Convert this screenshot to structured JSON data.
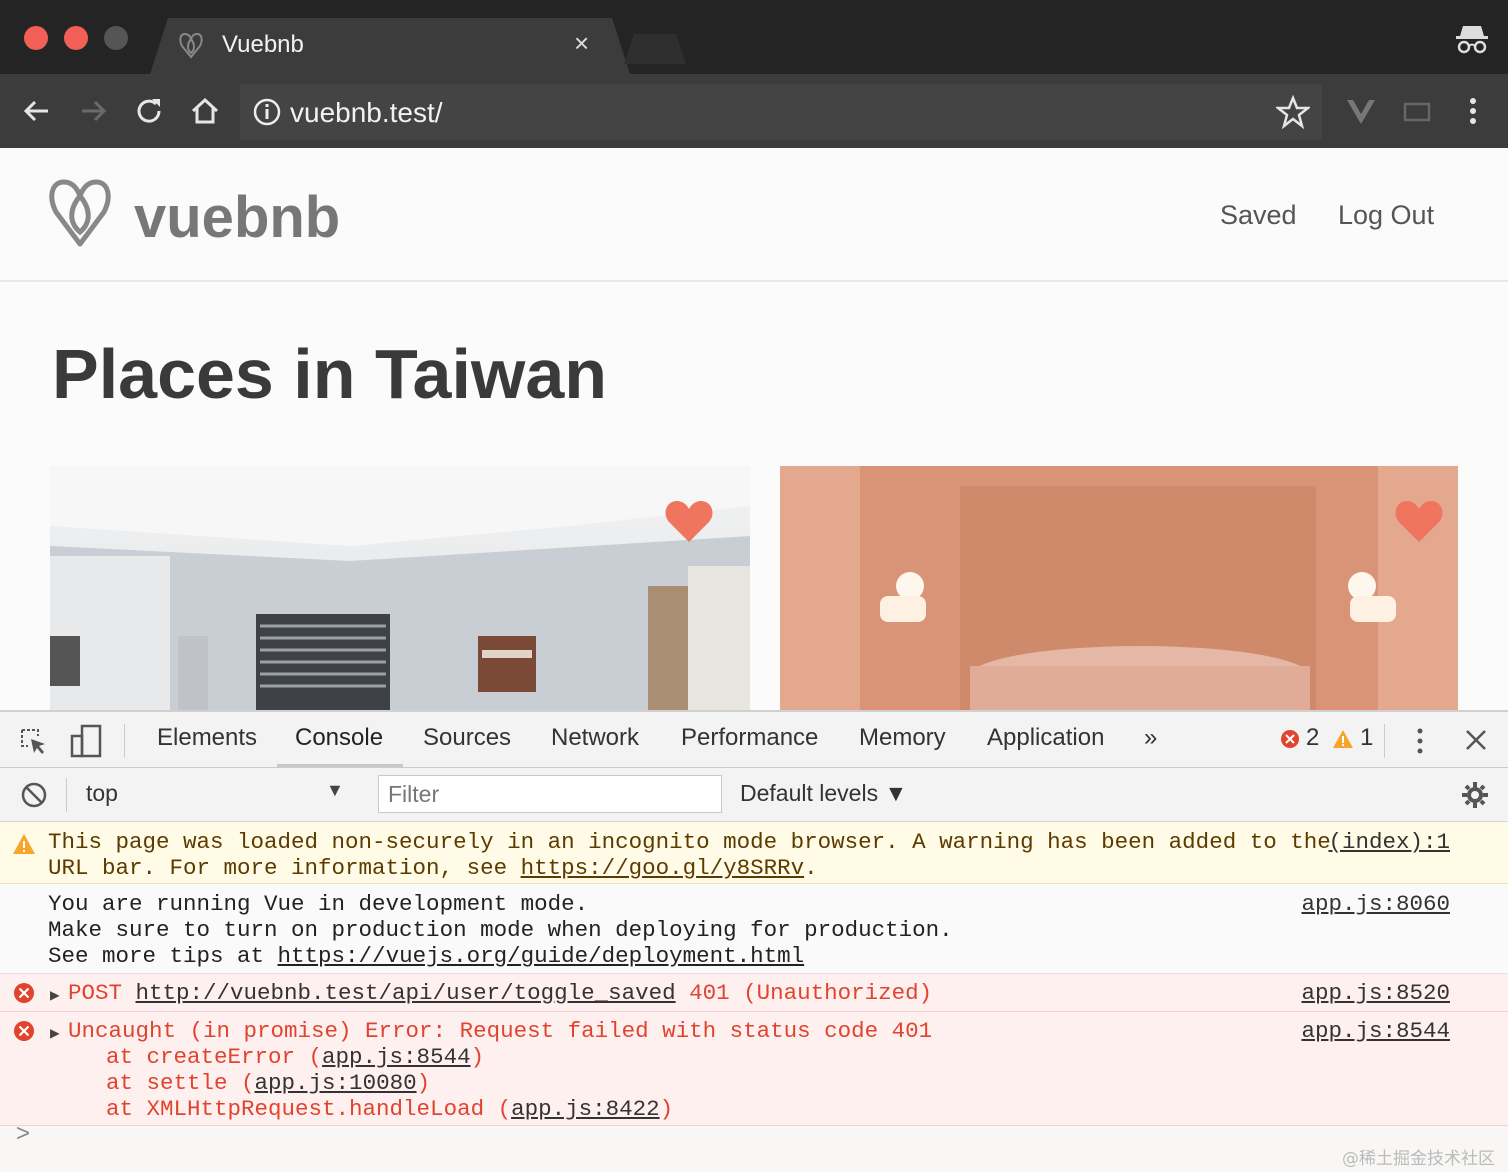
{
  "browser": {
    "tab_title": "Vuebnb",
    "tab_close": "×",
    "url": "vuebnb.test/"
  },
  "site": {
    "logo_text": "vuebnb",
    "nav": {
      "saved": "Saved",
      "logout": "Log Out"
    },
    "heading": "Places in Taiwan"
  },
  "colors": {
    "heart": "#f0755e",
    "error": "#e0442e",
    "warning_icon": "#f4a52a"
  },
  "devtools": {
    "tabs": [
      "Elements",
      "Console",
      "Sources",
      "Network",
      "Performance",
      "Memory",
      "Application"
    ],
    "active_tab": "Console",
    "overflow": "»",
    "error_count": "2",
    "warning_count": "1",
    "context": "top",
    "filter_placeholder": "Filter",
    "levels": "Default levels",
    "messages": {
      "warning": {
        "line1": "This page was loaded non-securely in an incognito mode browser. A warning has been added to the",
        "line2_text": "URL bar. For more information, see ",
        "line2_link": "https://goo.gl/y8SRRv",
        "line2_end": ".",
        "source": "(index):1"
      },
      "vue_dev": {
        "line1": "You are running Vue in development mode.",
        "line2": "Make sure to turn on production mode when deploying for production.",
        "line3_text": "See more tips at ",
        "line3_link": "https://vuejs.org/guide/deployment.html",
        "source": "app.js:8060"
      },
      "post_error": {
        "method": "POST ",
        "url": "http://vuebnb.test/api/user/toggle_saved",
        "status": " 401 (Unauthorized)",
        "source": "app.js:8520"
      },
      "promise_error": {
        "line1": "Uncaught (in promise) Error: Request failed with status code 401",
        "stack1_pre": "    at createError (",
        "stack1_link": "app.js:8544",
        "stack2_pre": "    at settle (",
        "stack2_link": "app.js:10080",
        "stack3_pre": "    at XMLHttpRequest.handleLoad (",
        "stack3_link": "app.js:8422",
        "close": ")",
        "source": "app.js:8544"
      }
    },
    "prompt": ">"
  },
  "watermark": "@稀土掘金技术社区"
}
